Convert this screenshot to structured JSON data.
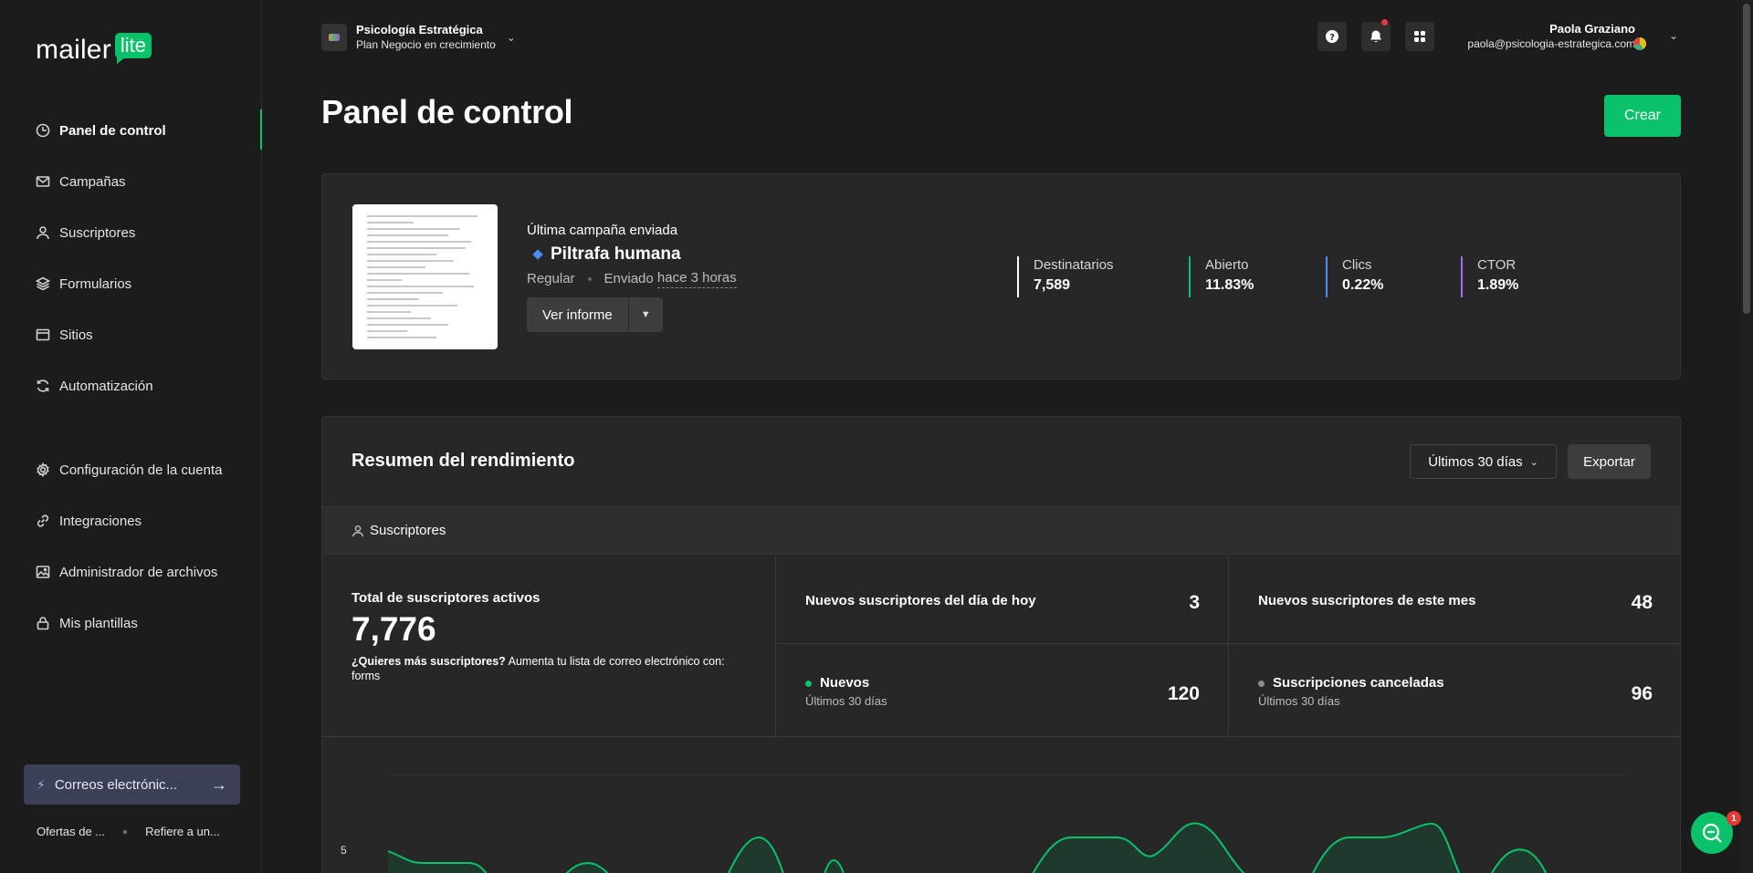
{
  "brand": {
    "logo_word": "mailer",
    "logo_badge": "lite",
    "accent": "#09c269"
  },
  "sidebar": {
    "items": [
      {
        "label": "Panel de control",
        "icon": "clock-icon",
        "active": true
      },
      {
        "label": "Campañas",
        "icon": "mail-icon"
      },
      {
        "label": "Suscriptores",
        "icon": "user-icon"
      },
      {
        "label": "Formularios",
        "icon": "layers-icon"
      },
      {
        "label": "Sitios",
        "icon": "browser-icon"
      },
      {
        "label": "Automatización",
        "icon": "refresh-icon"
      },
      {
        "label": "Configuración de la cuenta",
        "icon": "gear-icon"
      },
      {
        "label": "Integraciones",
        "icon": "link-icon"
      },
      {
        "label": "Administrador de archivos",
        "icon": "image-icon"
      },
      {
        "label": "Mis plantillas",
        "icon": "lock-icon"
      }
    ],
    "promo_label": "Correos electrónic...",
    "footer_links": [
      "Ofertas de ...",
      "Refiere a un..."
    ]
  },
  "topbar": {
    "org_name": "Psicología Estratégica",
    "org_plan": "Plan Negocio en crecimiento",
    "user_name": "Paola Graziano",
    "user_email": "paola@psicologia-estrategica.com"
  },
  "page": {
    "title": "Panel de control",
    "create_label": "Crear"
  },
  "last_campaign": {
    "label": "Última campaña enviada",
    "name": "Piltrafa humana",
    "type": "Regular",
    "sent_prefix": "Enviado",
    "sent_when": "hace 3 horas",
    "report_label": "Ver informe",
    "stats": [
      {
        "label": "Destinatarios",
        "value": "7,589",
        "color": "#ffffff"
      },
      {
        "label": "Abierto",
        "value": "11.83%",
        "color": "#09c269"
      },
      {
        "label": "Clics",
        "value": "0.22%",
        "color": "#4a8df8"
      },
      {
        "label": "CTOR",
        "value": "1.89%",
        "color": "#a66ee8"
      }
    ]
  },
  "performance": {
    "title": "Resumen del rendimiento",
    "range_label": "Últimos 30 días",
    "export_label": "Exportar",
    "section_label": "Suscriptores",
    "total_label": "Total de suscriptores activos",
    "total_value": "7,776",
    "total_note_bold": "¿Quieres más suscriptores?",
    "total_note_rest": " Aumenta tu lista de correo electrónico con:",
    "total_note_link": "forms",
    "today_label": "Nuevos suscriptores del día de hoy",
    "today_value": "3",
    "month_label": "Nuevos suscriptores de este mes",
    "month_value": "48",
    "new_label": "Nuevos",
    "new_sub": "Últimos 30 días",
    "new_value": "120",
    "unsub_label": "Suscripciones canceladas",
    "unsub_sub": "Últimos 30 días",
    "unsub_value": "96",
    "y_tick": "5"
  },
  "chat": {
    "badge": "1"
  }
}
